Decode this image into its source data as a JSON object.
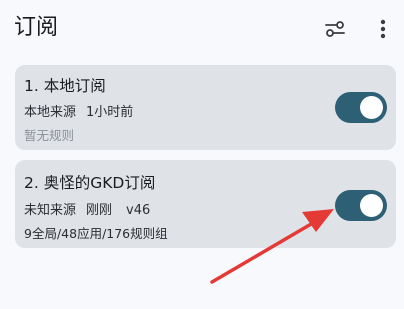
{
  "header": {
    "title": "订阅",
    "filter_icon": "tune-icon",
    "more_icon": "more-vert-icon"
  },
  "subscriptions": [
    {
      "title": "1. 本地订阅",
      "source": "本地来源",
      "updated": "1小时前",
      "note": "暂无规则",
      "enabled": true
    },
    {
      "title": "2. 奥怪的GKD订阅",
      "source": "未知来源",
      "updated": "刚刚",
      "version": "v46",
      "stats": "9全局/48应用/176规则组",
      "enabled": true
    }
  ],
  "colors": {
    "background": "#f7f9fc",
    "card": "#dfe3e8",
    "switch_on": "#2d5f75",
    "annotation_arrow": "#e53935"
  }
}
